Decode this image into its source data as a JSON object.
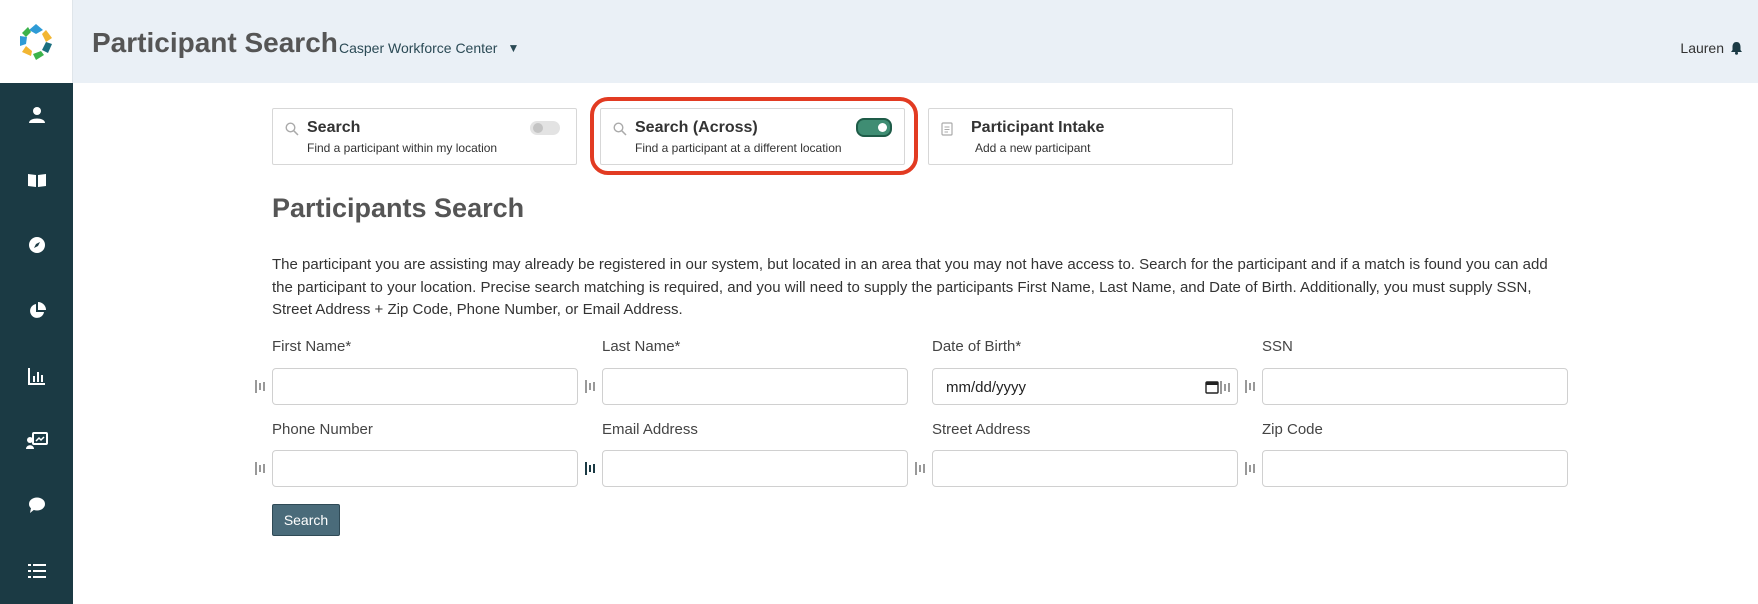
{
  "header": {
    "title": "Participant Search",
    "location": "Casper Workforce Center",
    "user_name": "Lauren"
  },
  "sidebar": {
    "items": [
      {
        "icon": "person-icon"
      },
      {
        "icon": "book-icon"
      },
      {
        "icon": "compass-icon"
      },
      {
        "icon": "pie-chart-icon"
      },
      {
        "icon": "bar-chart-icon"
      },
      {
        "icon": "presentation-icon"
      },
      {
        "icon": "chat-icon"
      },
      {
        "icon": "list-icon"
      }
    ]
  },
  "modes": [
    {
      "title": "Search",
      "subtitle": "Find a participant within my location",
      "toggle": "off"
    },
    {
      "title": "Search (Across)",
      "subtitle": "Find a participant at a different location",
      "toggle": "on"
    },
    {
      "title": "Participant Intake",
      "subtitle": "Add a new participant"
    }
  ],
  "main": {
    "section_title": "Participants Search",
    "description": "The participant you are assisting may already be registered in our system, but located in an area that you may not have access to. Search for the participant and if a match is found you can add the participant to your location. Precise search matching is required, and you will need to supply the participants First Name, Last Name, and Date of Birth. Additionally, you must supply SSN, Street Address + Zip Code, Phone Number, or Email Address."
  },
  "form": {
    "fields": [
      {
        "label": "First Name*",
        "value": ""
      },
      {
        "label": "Last Name*",
        "value": ""
      },
      {
        "label": "Date of Birth*",
        "placeholder": "mm/dd/yyyy"
      },
      {
        "label": "SSN",
        "value": ""
      },
      {
        "label": "Phone Number",
        "value": ""
      },
      {
        "label": "Email Address",
        "value": ""
      },
      {
        "label": "Street Address",
        "value": ""
      },
      {
        "label": "Zip Code",
        "value": ""
      }
    ],
    "search_button": "Search"
  },
  "colors": {
    "sidebar": "#1b3a44",
    "header_bg": "#eaf0f6",
    "toggle_on": "#3f8d73",
    "highlight": "#e23b22",
    "button": "#4a6b7a"
  }
}
